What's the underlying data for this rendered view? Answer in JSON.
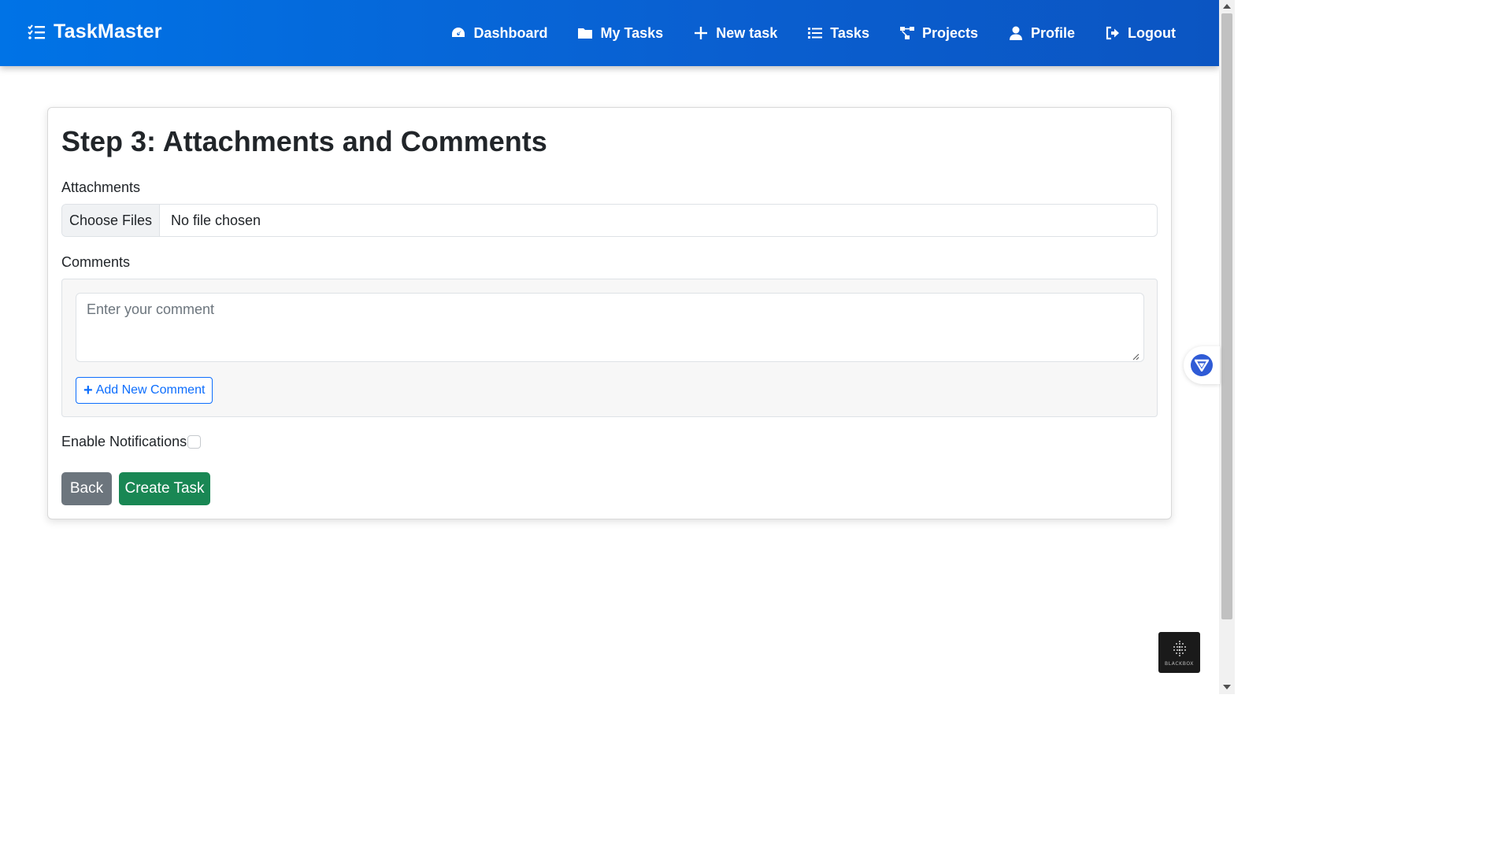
{
  "app": {
    "brand": "TaskMaster",
    "brand_icon": "list-check-icon"
  },
  "nav": {
    "items": [
      {
        "label": "Dashboard",
        "icon": "gauge-icon"
      },
      {
        "label": "My Tasks",
        "icon": "folder-icon"
      },
      {
        "label": "New task",
        "icon": "plus-icon"
      },
      {
        "label": "Tasks",
        "icon": "list-icon"
      },
      {
        "label": "Projects",
        "icon": "project-diagram-icon"
      },
      {
        "label": "Profile",
        "icon": "user-icon"
      },
      {
        "label": "Logout",
        "icon": "sign-out-icon"
      }
    ]
  },
  "form": {
    "title": "Step 3: Attachments and Comments",
    "attachments_label": "Attachments",
    "file_button": "Choose Files",
    "file_status": "No file chosen",
    "comments_label": "Comments",
    "comment_placeholder": "Enter your comment",
    "add_comment_label": "Add New Comment",
    "notifications_label": "Enable Notifications",
    "notifications_checked": false,
    "back_label": "Back",
    "create_label": "Create Task"
  },
  "widgets": {
    "blackbox_label": "BLACKBOX"
  },
  "colors": {
    "nav_bg": "#0a64d8",
    "primary": "#0d6efd",
    "secondary": "#6c757d",
    "success": "#198754"
  }
}
